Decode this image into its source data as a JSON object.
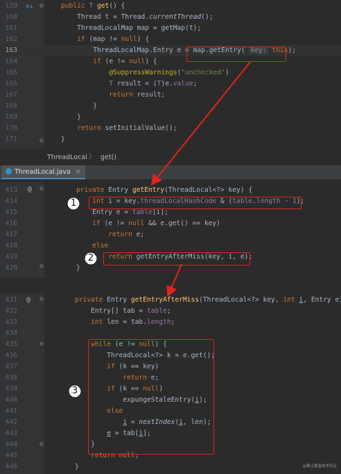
{
  "panel1": {
    "lines": [
      {
        "num": "159",
        "html": "<span class='kw'>public</span> <span class='fld'>T</span> <span class='fn'>get</span>() {"
      },
      {
        "num": "160",
        "html": "    Thread t = Thread.<span class='it'>currentThread</span>();"
      },
      {
        "num": "161",
        "html": "    ThreadLocalMap map = getMap(t);"
      },
      {
        "num": "162",
        "html": "    <span class='kw'>if</span> (map != <span class='kw'>null</span>) {"
      },
      {
        "num": "163",
        "html": "        ThreadLocalMap.Entry e = map.getEntry( <span class='hint'>key:</span> <span class='kw'>this</span>);"
      },
      {
        "num": "164",
        "html": "        <span class='kw'>if</span> (e != <span class='kw'>null</span>) {"
      },
      {
        "num": "165",
        "html": "            <span class='ann'>@SuppressWarnings</span>(<span class='str'>\"unchecked\"</span>)"
      },
      {
        "num": "166",
        "html": "            <span class='fld'>T</span> result = (<span class='fld'>T</span>)e.<span class='fld'>value</span>;"
      },
      {
        "num": "167",
        "html": "            <span class='kw'>return</span> result;"
      },
      {
        "num": "168",
        "html": "        }"
      },
      {
        "num": "169",
        "html": "    }"
      },
      {
        "num": "170",
        "html": "    <span class='kw'>return</span> setInitialValue();"
      },
      {
        "num": "171",
        "html": "}"
      }
    ]
  },
  "breadcrumb": {
    "class_name": "ThreadLocal",
    "separator": "〉",
    "method": "get()"
  },
  "tab": {
    "file_name": "ThreadLocal.java",
    "close": "×"
  },
  "panel2": {
    "lines": [
      {
        "num": "413",
        "html": "<span class='kw'>private</span> Entry <span class='fn'>getEntry</span>(ThreadLocal&lt;?&gt; key) {"
      },
      {
        "num": "414",
        "html": "    <span class='kw'>int</span> i = key.<span class='fld'>threadLocalHashCode</span> &amp; (<span class='fld'>table</span>.<span class='fld'>length</span> - <span style='color:#6897bb'>1</span>);"
      },
      {
        "num": "415",
        "html": "    Entry e = <span class='fld'>table</span>[i];"
      },
      {
        "num": "416",
        "html": "    <span class='kw'>if</span> (e != <span class='kw'>null</span> &amp;&amp; e.get() == key)"
      },
      {
        "num": "417",
        "html": "        <span class='kw'>return</span> e;"
      },
      {
        "num": "418",
        "html": "    <span class='kw'>else</span>"
      },
      {
        "num": "419",
        "html": "        <span class='kw'>return</span> getEntryAfterMiss(key, i, e);"
      },
      {
        "num": "420",
        "html": "}"
      }
    ]
  },
  "panel3": {
    "lines": [
      {
        "num": "431",
        "html": "<span class='kw'>private</span> Entry <span class='fn'>getEntryAfterMiss</span>(ThreadLocal&lt;?&gt; key, <span class='kw'>int</span> <span class='ul'>i</span>, Entry e) {"
      },
      {
        "num": "432",
        "html": "    Entry[] tab = <span class='fld'>table</span>;"
      },
      {
        "num": "433",
        "html": "    <span class='kw'>int</span> len = tab.<span class='fld'>length</span>;"
      },
      {
        "num": "434",
        "html": ""
      },
      {
        "num": "435",
        "html": "    <span class='kw'>while</span> (e != <span class='kw'>null</span>) {"
      },
      {
        "num": "436",
        "html": "        ThreadLocal&lt;?&gt; k = e.get();"
      },
      {
        "num": "437",
        "html": "        <span class='kw'>if</span> (k == key)"
      },
      {
        "num": "438",
        "html": "            <span class='kw'>return</span> e;"
      },
      {
        "num": "439",
        "html": "        <span class='kw'>if</span> (k == <span class='kw'>null</span>)"
      },
      {
        "num": "440",
        "html": "            expungeStaleEntry(<span class='ul'>i</span>);"
      },
      {
        "num": "441",
        "html": "        <span class='kw'>else</span>"
      },
      {
        "num": "442",
        "html": "            <span class='ul'>i</span> = <span class='it'>nextIndex</span>(<span class='ul'>i</span>, len);"
      },
      {
        "num": "443",
        "html": "        <span class='ul'>e</span> = tab[<span class='ul'>i</span>];"
      },
      {
        "num": "444",
        "html": "    }"
      },
      {
        "num": "445",
        "html": "    <span class='kw'>return</span> <span class='kw'>null</span>;"
      },
      {
        "num": "446",
        "html": "}"
      }
    ]
  },
  "markers": {
    "one": "1",
    "two": "2",
    "three": "3"
  },
  "watermark": "@稀土掘金技术社区",
  "colors": {
    "accent_red": "#e0241b",
    "keyword": "#cc7832",
    "method": "#ffc66d",
    "field": "#9876aa"
  }
}
